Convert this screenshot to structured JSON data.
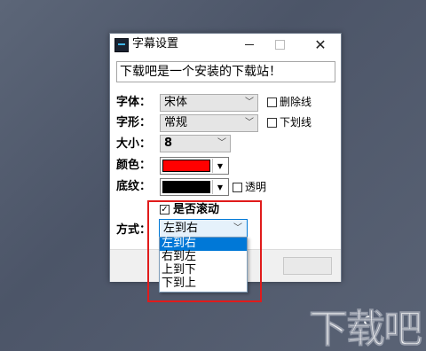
{
  "window": {
    "title": "字幕设置",
    "minimize_glyph": "",
    "close_glyph": "✕"
  },
  "subtitle_text": "下载吧是一个安装的下载站！",
  "font": {
    "label": "字体：",
    "value": "宋体",
    "strike_label": "删除线"
  },
  "style": {
    "label": "字形：",
    "value": "常规",
    "underline_label": "下划线"
  },
  "size": {
    "label": "大小：",
    "value": "8"
  },
  "color": {
    "label": "颜色：",
    "swatch": "#ff0000"
  },
  "background": {
    "label": "底纹：",
    "swatch": "#000000",
    "transparent_label": "透明"
  },
  "scroll": {
    "label": "是否滚动",
    "checked": true
  },
  "mode": {
    "label": "方式：",
    "value": "左到右",
    "options": [
      "左到右",
      "右到左",
      "上到下",
      "下到上"
    ],
    "selected_index": 0
  },
  "watermark": "下载吧",
  "colors": {
    "highlight": "#e01b1b",
    "selection": "#0078d7"
  }
}
